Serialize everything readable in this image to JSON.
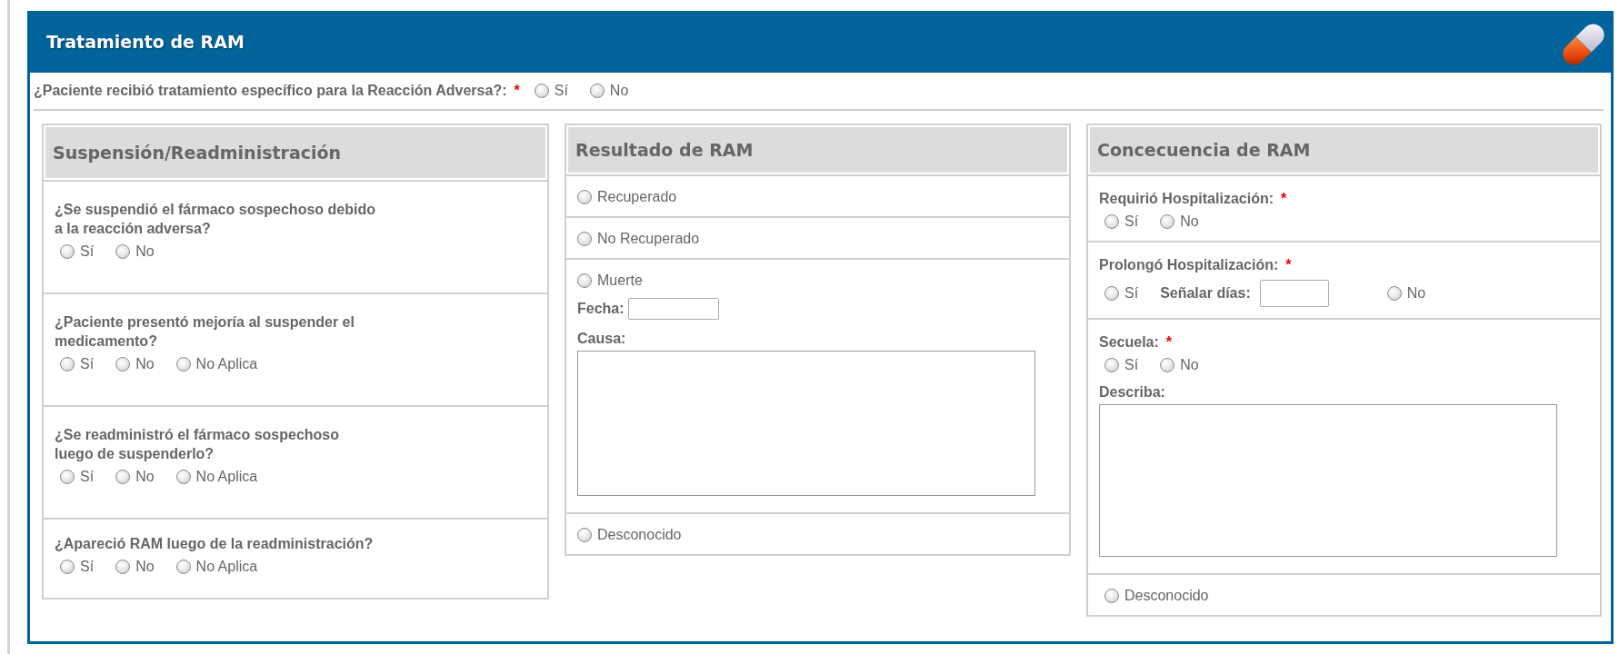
{
  "panel": {
    "title": "Tratamiento de RAM"
  },
  "main_question": {
    "label": "¿Paciente recibió tratamiento específico para la Reacción Adversa?:",
    "required_mark": "*",
    "options": [
      {
        "kind": "radio",
        "label": "Sí",
        "selected": false
      },
      {
        "kind": "radio",
        "label": "No",
        "selected": false
      }
    ]
  },
  "columns": [
    {
      "title": "Suspensión/Readministración",
      "sections": [
        {
          "items": [
            {
              "kind": "question",
              "label": "¿Se suspendió el fármaco sospechoso debido\na la reacción adversa?"
            },
            {
              "kind": "radios",
              "options": [
                {
                  "kind": "radio",
                  "label": "Sí",
                  "selected": false
                },
                {
                  "kind": "radio",
                  "label": "No",
                  "selected": false
                }
              ]
            }
          ]
        },
        {
          "items": [
            {
              "kind": "question",
              "label": "¿Paciente presentó mejoría al suspender el\nmedicamento?"
            },
            {
              "kind": "radios",
              "options": [
                {
                  "kind": "radio",
                  "label": "Sí",
                  "selected": false
                },
                {
                  "kind": "radio",
                  "label": "No",
                  "selected": false
                },
                {
                  "kind": "radio",
                  "label": "No Aplica",
                  "selected": false
                }
              ]
            }
          ]
        },
        {
          "items": [
            {
              "kind": "question",
              "label": "¿Se readministró el fármaco sospechoso\nluego de suspenderlo?"
            },
            {
              "kind": "radios",
              "options": [
                {
                  "kind": "radio",
                  "label": "Sí",
                  "selected": false
                },
                {
                  "kind": "radio",
                  "label": "No",
                  "selected": false
                },
                {
                  "kind": "radio",
                  "label": "No Aplica",
                  "selected": false
                }
              ]
            }
          ]
        },
        {
          "items": [
            {
              "kind": "question",
              "label": "¿Apareció RAM luego de la readministración?"
            },
            {
              "kind": "radios",
              "options": [
                {
                  "kind": "radio",
                  "label": "Sí",
                  "selected": false
                },
                {
                  "kind": "radio",
                  "label": "No",
                  "selected": false
                },
                {
                  "kind": "radio",
                  "label": "No Aplica",
                  "selected": false
                }
              ]
            }
          ]
        }
      ]
    },
    {
      "title": "Resultado de RAM",
      "sections": [
        {
          "items": [
            {
              "kind": "radios",
              "options": [
                {
                  "kind": "radio",
                  "label": "Recuperado",
                  "selected": false
                }
              ]
            }
          ]
        },
        {
          "items": [
            {
              "kind": "radios",
              "options": [
                {
                  "kind": "radio",
                  "label": "No Recuperado",
                  "selected": false
                }
              ]
            }
          ]
        },
        {
          "items": [
            {
              "kind": "radios",
              "options": [
                {
                  "kind": "radio",
                  "label": "Muerte",
                  "selected": false
                }
              ]
            },
            {
              "kind": "field",
              "label": "Fecha:"
            },
            {
              "kind": "textarea",
              "label": "Causa:"
            }
          ]
        },
        {
          "items": [
            {
              "kind": "radios",
              "options": [
                {
                  "kind": "radio",
                  "label": "Desconocido",
                  "selected": false
                }
              ]
            }
          ]
        }
      ]
    },
    {
      "title": "Concecuencia de RAM",
      "sections": [
        {
          "items": [
            {
              "kind": "question",
              "label": "Requirió Hospitalización:",
              "required_mark": "*"
            },
            {
              "kind": "radios",
              "options": [
                {
                  "kind": "radio",
                  "label": "Sí",
                  "selected": false
                },
                {
                  "kind": "radio",
                  "label": "No",
                  "selected": false
                }
              ]
            }
          ]
        },
        {
          "items": [
            {
              "kind": "question",
              "label": "Prolongó Hospitalización:",
              "required_mark": "*"
            },
            {
              "kind": "radios",
              "options": [
                {
                  "kind": "radio",
                  "label": "Sí",
                  "selected": false
                },
                {
                  "kind": "field",
                  "label": "Señalar días:"
                },
                {
                  "kind": "radio",
                  "label": "No",
                  "selected": false
                }
              ]
            }
          ]
        },
        {
          "items": [
            {
              "kind": "question",
              "label": "Secuela:",
              "required_mark": "*"
            },
            {
              "kind": "radios",
              "options": [
                {
                  "kind": "radio",
                  "label": "Sí",
                  "selected": false
                },
                {
                  "kind": "radio",
                  "label": "No",
                  "selected": false
                }
              ]
            },
            {
              "kind": "textarea",
              "label": "Describa:"
            }
          ]
        },
        {
          "items": [
            {
              "kind": "radios",
              "options": [
                {
                  "kind": "radio",
                  "label": "Desconocido",
                  "selected": false
                }
              ]
            }
          ]
        }
      ]
    }
  ]
}
